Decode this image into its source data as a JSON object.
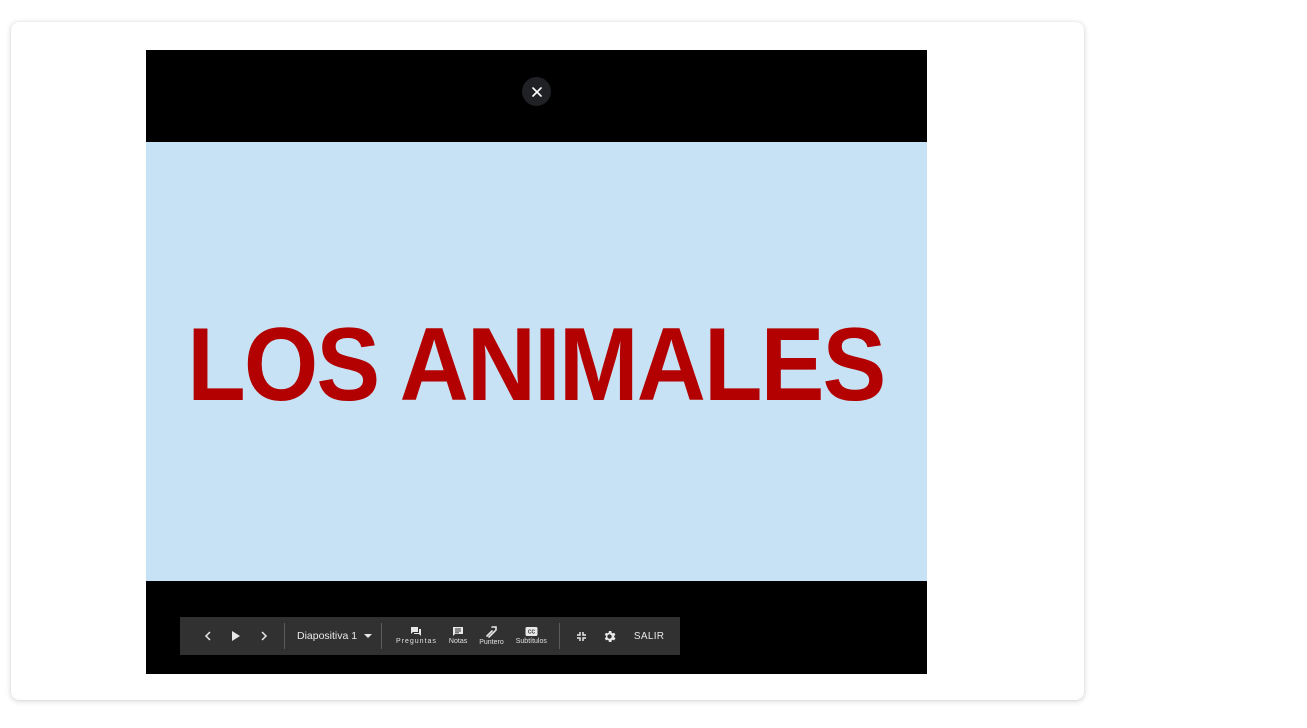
{
  "presentation": {
    "slide_title": "LOS ANIMALES",
    "slide_background": "#c7e2f4",
    "title_color": "#b30000"
  },
  "overlay": {
    "close_icon": "close-icon"
  },
  "toolbar": {
    "prev_icon": "chevron-left-icon",
    "play_icon": "play-icon",
    "next_icon": "chevron-right-icon",
    "slide_selector": "Diapositiva 1",
    "dropdown_icon": "caret-down-icon",
    "questions_label": "Preguntas",
    "notes_label": "Notas",
    "pointer_label": "Puntero",
    "captions_label": "Subtítulos",
    "exit_fullscreen_icon": "fullscreen-exit-icon",
    "settings_icon": "gear-icon",
    "exit_label": "SALIR"
  }
}
